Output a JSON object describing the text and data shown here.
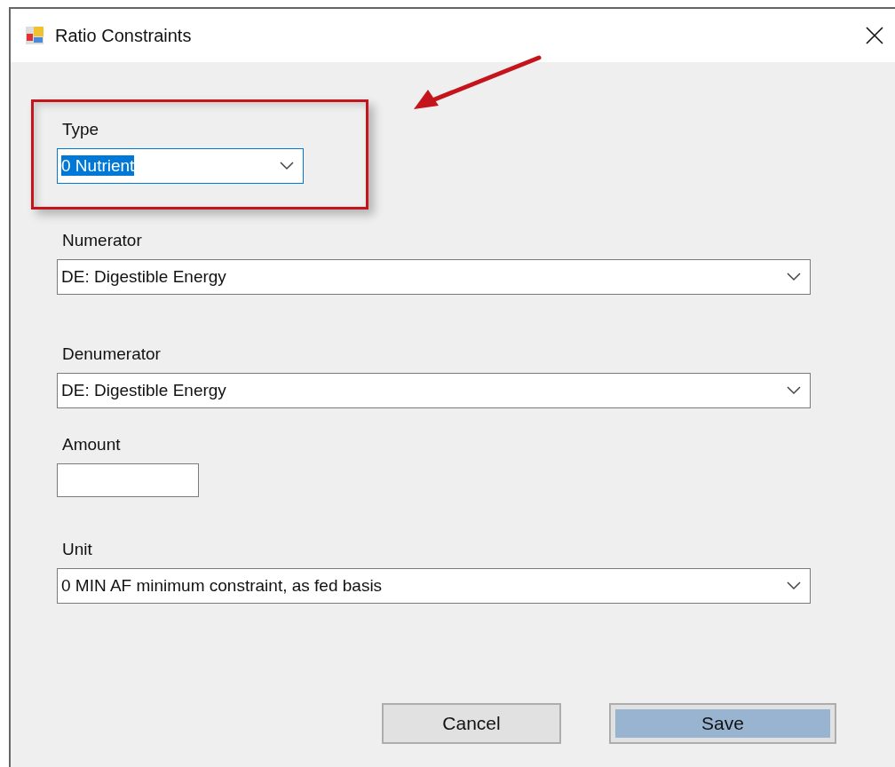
{
  "window": {
    "title": "Ratio Constraints"
  },
  "fields": [
    {
      "kind": "combo",
      "label": "Type",
      "value": "0 Nutrient",
      "focused": true,
      "highlighted": true
    },
    {
      "kind": "combo",
      "label": "Numerator",
      "value": "DE: Digestible Energy",
      "focused": false,
      "highlighted": false
    },
    {
      "kind": "combo",
      "label": "Denumerator",
      "value": "DE: Digestible Energy",
      "focused": false,
      "highlighted": false
    },
    {
      "kind": "text",
      "label": "Amount",
      "focused": false,
      "highlighted": false
    },
    {
      "kind": "combo",
      "label": "Unit",
      "value": "0 MIN AF minimum constraint, as fed basis",
      "focused": false,
      "highlighted": false
    }
  ],
  "buttons": [
    {
      "label": "Cancel",
      "default": false
    },
    {
      "label": "Save",
      "default": true
    }
  ]
}
